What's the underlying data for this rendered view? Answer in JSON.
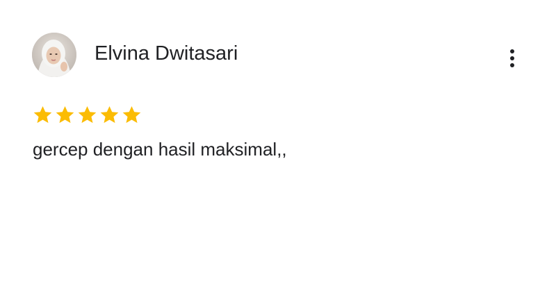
{
  "review": {
    "reviewer_name": "Elvina Dwitasari",
    "rating": 5,
    "rating_max": 5,
    "text": "gercep dengan hasil maksimal,,",
    "avatar_icon": "profile-photo",
    "more_icon": "more-vert-icon",
    "star_color": "#fbbc04"
  }
}
